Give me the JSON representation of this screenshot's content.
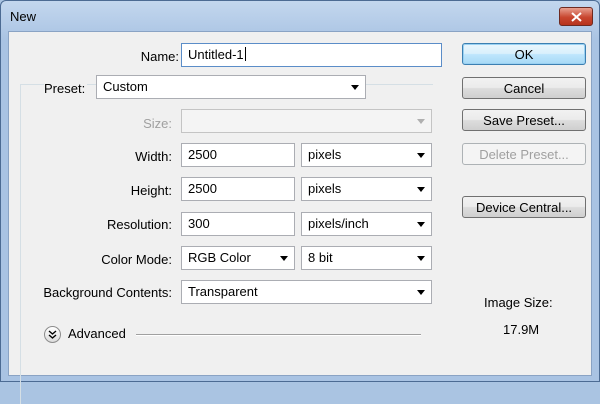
{
  "window": {
    "title": "New"
  },
  "form": {
    "name_label": "Name:",
    "name_value": "Untitled-1",
    "preset_label": "Preset:",
    "preset_value": "Custom",
    "size_label": "Size:",
    "size_value": "",
    "width_label": "Width:",
    "width_value": "2500",
    "width_unit": "pixels",
    "height_label": "Height:",
    "height_value": "2500",
    "height_unit": "pixels",
    "resolution_label": "Resolution:",
    "resolution_value": "300",
    "resolution_unit": "pixels/inch",
    "color_mode_label": "Color Mode:",
    "color_mode_value": "RGB Color",
    "bit_depth_value": "8 bit",
    "background_label": "Background Contents:",
    "background_value": "Transparent",
    "advanced_label": "Advanced"
  },
  "buttons": {
    "ok": "OK",
    "cancel": "Cancel",
    "save_preset": "Save Preset...",
    "delete_preset": "Delete Preset...",
    "device_central": "Device Central..."
  },
  "info": {
    "image_size_label": "Image Size:",
    "image_size_value": "17.9M"
  },
  "icons": {
    "close": "close-icon",
    "dropdown": "chevron-down-icon",
    "advanced_toggle": "double-chevron-down-icon"
  },
  "colors": {
    "title_bar": "#aac4e2",
    "close_button": "#c8462f",
    "default_button": "#bee6fd",
    "dialog_bg": "#f0f0f0"
  }
}
